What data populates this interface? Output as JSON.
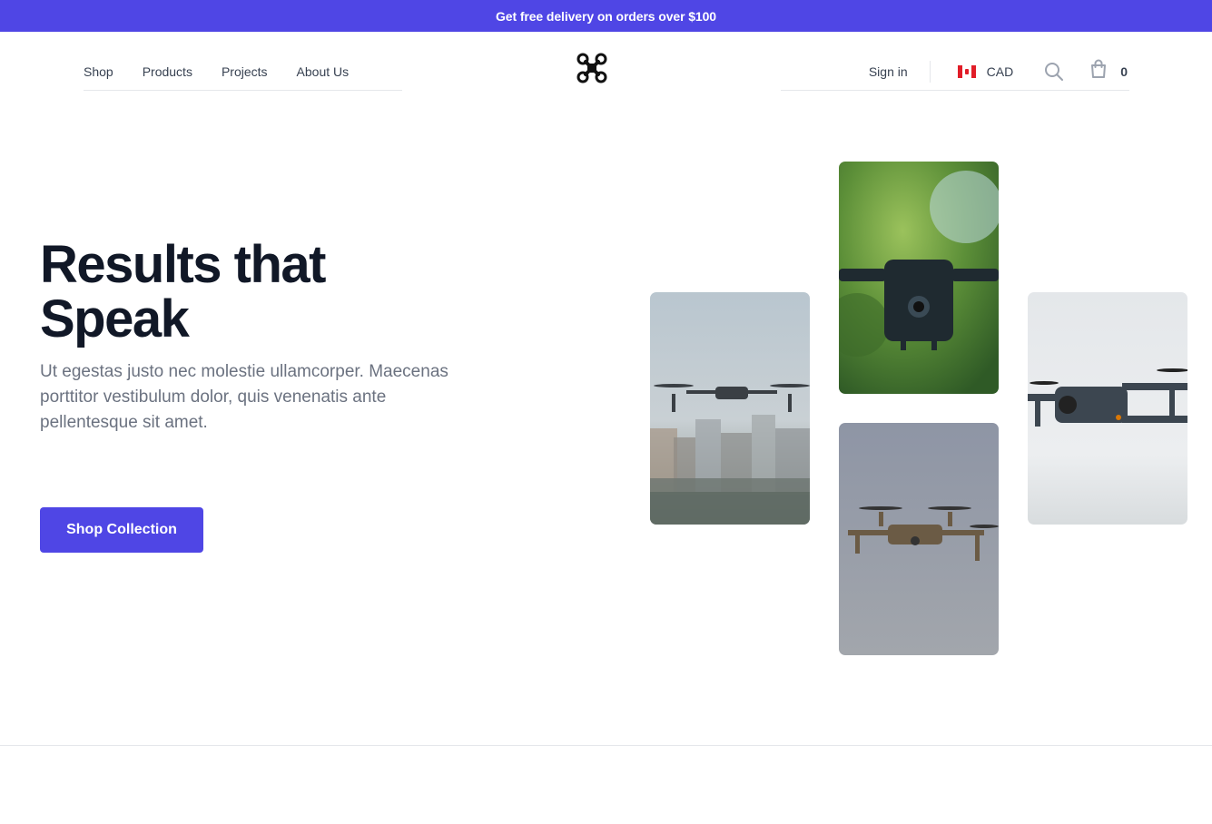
{
  "promo": {
    "text": "Get free delivery on orders over $100"
  },
  "nav": {
    "left": [
      {
        "label": "Shop"
      },
      {
        "label": "Products"
      },
      {
        "label": "Projects"
      },
      {
        "label": "About Us"
      }
    ],
    "sign_in": "Sign in",
    "currency": "CAD",
    "cart_count": "0"
  },
  "icons": {
    "logo": "drone-logo-icon",
    "flag": "canada-flag-icon",
    "search": "search-icon",
    "cart": "shopping-bag-icon"
  },
  "hero": {
    "title_line1": "Results that",
    "title_line2": "Speak",
    "subtitle": "Ut egestas justo nec molestie ullamcorper. Maecenas porttitor vestibulum dolor, quis venenatis ante pellentesque sit amet.",
    "cta_label": "Shop Collection"
  },
  "colors": {
    "accent": "#4f46e5",
    "heading": "#111827",
    "body_text": "#6b7280",
    "border": "#e5e7eb"
  }
}
